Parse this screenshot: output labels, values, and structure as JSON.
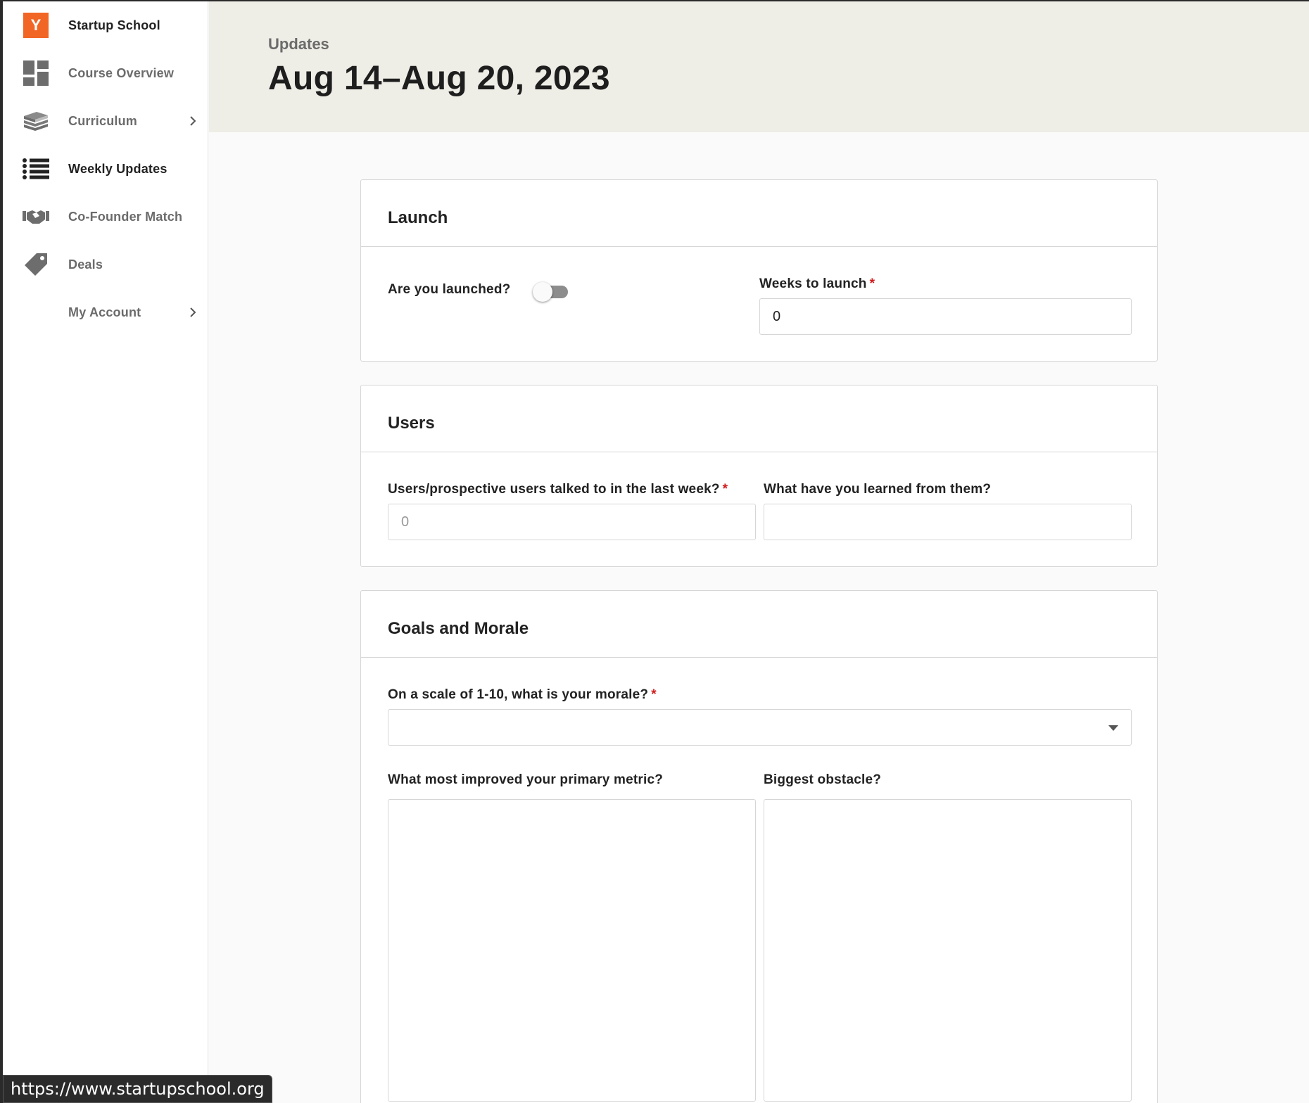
{
  "sidebar": {
    "brand": {
      "logo_letter": "Y",
      "label": "Startup School",
      "logo_color": "#f26625"
    },
    "items": [
      {
        "label": "Course Overview",
        "icon": "dashboard-icon"
      },
      {
        "label": "Curriculum",
        "icon": "books-icon",
        "has_chevron": true
      },
      {
        "label": "Weekly Updates",
        "icon": "list-icon",
        "active": true
      },
      {
        "label": "Co-Founder Match",
        "icon": "handshake-icon"
      },
      {
        "label": "Deals",
        "icon": "tag-icon"
      },
      {
        "label": "My Account",
        "has_chevron": true
      }
    ]
  },
  "header": {
    "eyebrow": "Updates",
    "title": "Aug 14–Aug 20, 2023"
  },
  "launch": {
    "title": "Launch",
    "launched_label": "Are you launched?",
    "launched_value": false,
    "weeks_label": "Weeks to launch",
    "weeks_required": "*",
    "weeks_value": "0"
  },
  "users": {
    "title": "Users",
    "talked_label": "Users/prospective users talked to in the last week?",
    "talked_required": "*",
    "talked_placeholder": "0",
    "learned_label": "What have you learned from them?",
    "learned_value": ""
  },
  "goals": {
    "title": "Goals and Morale",
    "morale_label": "On a scale of 1-10, what is your morale?",
    "morale_required": "*",
    "morale_value": "",
    "improved_label": "What most improved your primary metric?",
    "obstacle_label": "Biggest obstacle?"
  },
  "statusbar": {
    "url": "https://www.startupschool.org"
  }
}
